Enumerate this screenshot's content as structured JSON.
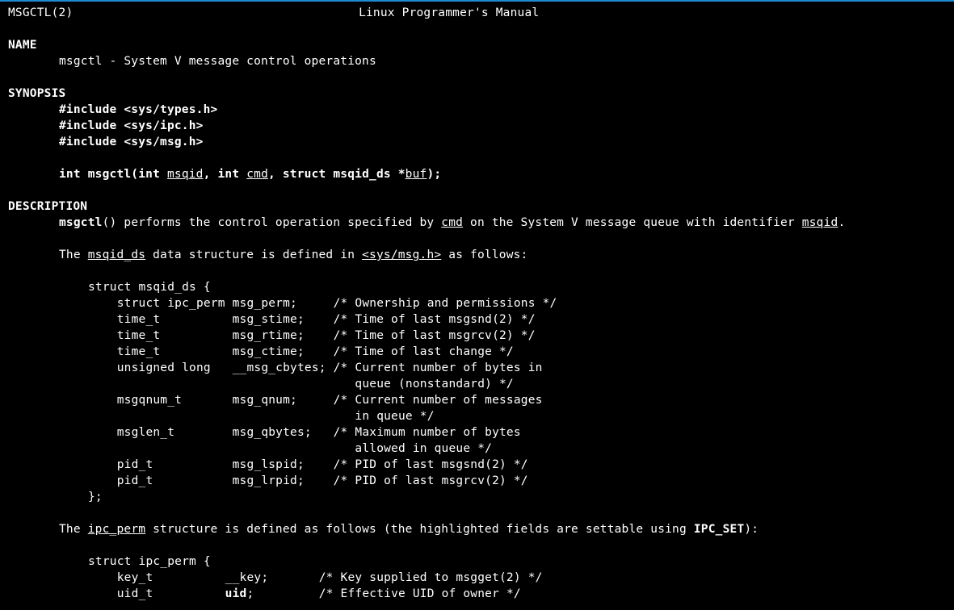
{
  "header": {
    "left": "MSGCTL(2)",
    "center": "Linux Programmer's Manual"
  },
  "sec": {
    "name_h": "NAME",
    "name_line": "msgctl - System V message control operations",
    "synopsis_h": "SYNOPSIS",
    "inc1": "#include <sys/types.h>",
    "inc2": "#include <sys/ipc.h>",
    "inc3": "#include <sys/msg.h>",
    "sig_pre": "int msgctl(int ",
    "sig_mid1": ", int ",
    "sig_mid2": ", struct msqid_ds *",
    "sig_end": ");",
    "sig_arg1": "msqid",
    "sig_arg2": "cmd",
    "sig_arg3": "buf",
    "desc_h": "DESCRIPTION",
    "desc1_fn": "msgctl",
    "desc1_a": "() performs the control operation specified by ",
    "desc1_cmd": "cmd",
    "desc1_b": " on the System V message queue with identifier ",
    "desc1_msqid": "msqid",
    "desc1_c": ".",
    "desc2_a": "The ",
    "desc2_struct": "msqid_ds",
    "desc2_b": " data structure is defined in ",
    "desc2_hdr": "<sys/msg.h>",
    "desc2_c": " as follows:",
    "struct1": "struct msqid_ds {\n    struct ipc_perm msg_perm;     /* Ownership and permissions */\n    time_t          msg_stime;    /* Time of last msgsnd(2) */\n    time_t          msg_rtime;    /* Time of last msgrcv(2) */\n    time_t          msg_ctime;    /* Time of last change */\n    unsigned long   __msg_cbytes; /* Current number of bytes in\n                                     queue (nonstandard) */\n    msgqnum_t       msg_qnum;     /* Current number of messages\n                                     in queue */\n    msglen_t        msg_qbytes;   /* Maximum number of bytes\n                                     allowed in queue */\n    pid_t           msg_lspid;    /* PID of last msgsnd(2) */\n    pid_t           msg_lrpid;    /* PID of last msgrcv(2) */\n};",
    "desc3_a": "The ",
    "desc3_struct": "ipc_perm",
    "desc3_b": " structure is defined as follows (the highlighted fields are settable using ",
    "desc3_set": "IPC_SET",
    "desc3_c": "):",
    "struct2_l1a": "struct ipc_perm {",
    "struct2_l2a": "    key_t          __key;       /* Key supplied to msgget(2) */",
    "struct2_l3a": "    uid_t          ",
    "struct2_l3b": "uid",
    "struct2_l3c": ";         /* Effective UID of owner */"
  }
}
